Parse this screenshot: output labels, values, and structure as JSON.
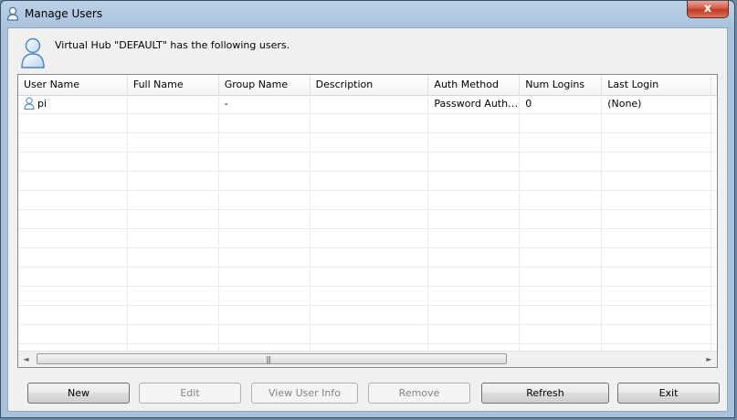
{
  "window": {
    "title": "Manage Users",
    "close_label": "x"
  },
  "header": {
    "text": "Virtual Hub \"DEFAULT\" has the following users."
  },
  "table": {
    "columns": [
      {
        "key": "user_name",
        "label": "User Name"
      },
      {
        "key": "full_name",
        "label": "Full Name"
      },
      {
        "key": "group_name",
        "label": "Group Name"
      },
      {
        "key": "description",
        "label": "Description"
      },
      {
        "key": "auth_method",
        "label": "Auth Method"
      },
      {
        "key": "num_logins",
        "label": "Num Logins"
      },
      {
        "key": "last_login",
        "label": "Last Login"
      }
    ],
    "rows": [
      {
        "user_name": "pi",
        "full_name": "",
        "group_name": "-",
        "description": "",
        "auth_method": "Password Authe...",
        "num_logins": "0",
        "last_login": "(None)"
      }
    ]
  },
  "scrollbar": {
    "left_arrow": "◄",
    "right_arrow": "►",
    "grip": "|||"
  },
  "buttons": {
    "new": {
      "label": "New",
      "enabled": true
    },
    "edit": {
      "label": "Edit",
      "enabled": false
    },
    "view_user_info": {
      "label": "View User Info",
      "enabled": false
    },
    "remove": {
      "label": "Remove",
      "enabled": false
    },
    "refresh": {
      "label": "Refresh",
      "enabled": true
    },
    "exit": {
      "label": "Exit",
      "enabled": true
    }
  }
}
